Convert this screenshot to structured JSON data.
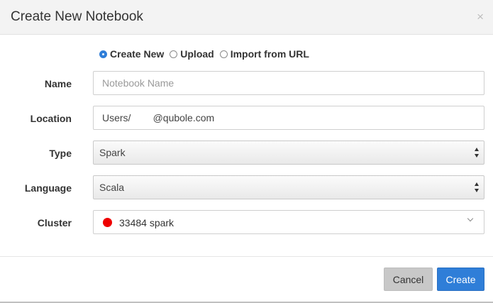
{
  "header": {
    "title": "Create New Notebook",
    "close_label": "×"
  },
  "mode_options": [
    {
      "label": "Create New",
      "checked": true
    },
    {
      "label": "Upload",
      "checked": false
    },
    {
      "label": "Import from URL",
      "checked": false
    }
  ],
  "form": {
    "name": {
      "label": "Name",
      "placeholder": "Notebook Name",
      "value": ""
    },
    "location": {
      "label": "Location",
      "value": "Users/        @qubole.com"
    },
    "type": {
      "label": "Type",
      "value": "Spark"
    },
    "language": {
      "label": "Language",
      "value": "Scala"
    },
    "cluster": {
      "label": "Cluster",
      "value": "33484 spark",
      "status_color": "#ee0000"
    }
  },
  "footer": {
    "cancel_label": "Cancel",
    "create_label": "Create"
  },
  "colors": {
    "primary": "#2f7ed8",
    "header_bg": "#f3f3f3",
    "cancel_bg": "#c8c8c8"
  }
}
